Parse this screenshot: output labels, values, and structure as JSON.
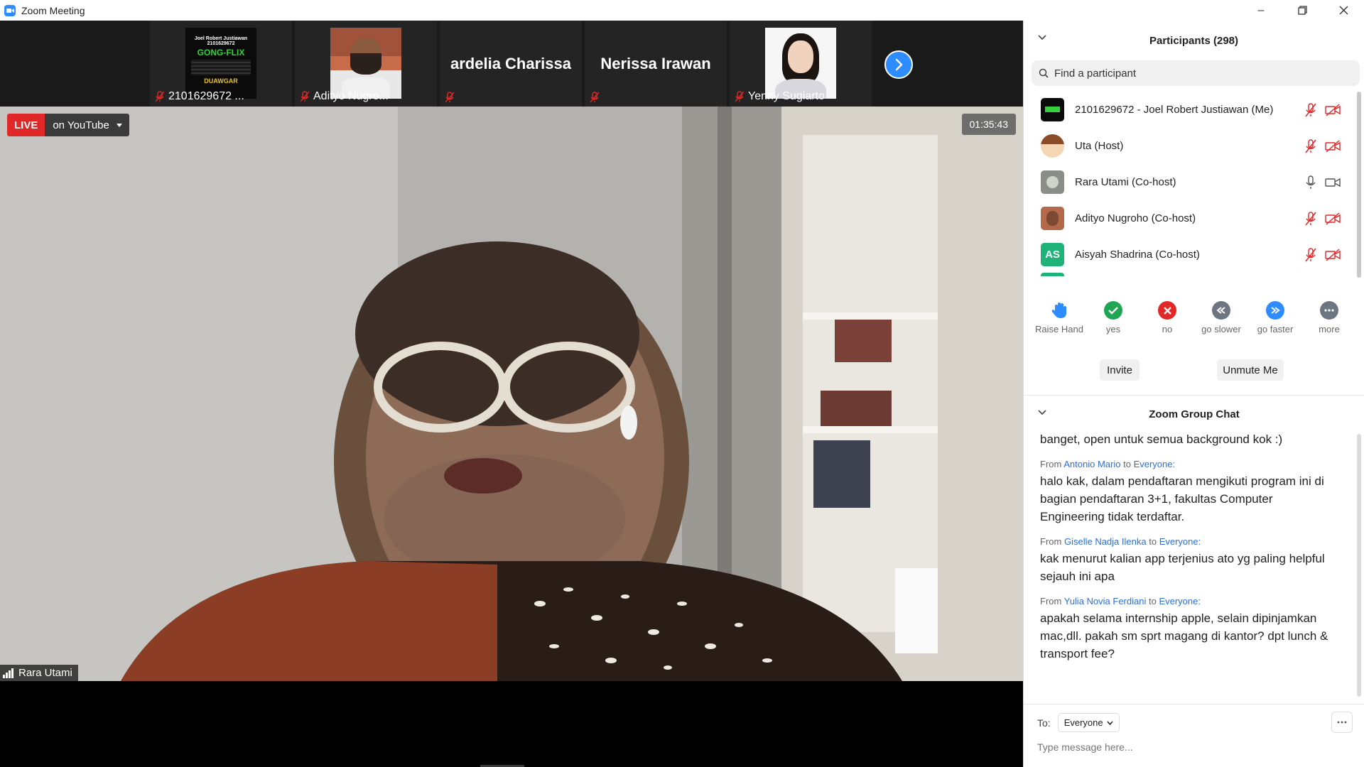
{
  "window": {
    "title": "Zoom Meeting"
  },
  "thumbnails": [
    {
      "name": "2101629672 ...",
      "image_text": [
        "Joel Robert Justiawan",
        "2101629672",
        "GONG-FLIX",
        "DUAWGAR"
      ]
    },
    {
      "name": "Adityo Nugro..."
    },
    {
      "name": "",
      "big_name": "ardelia Charissa"
    },
    {
      "name": "",
      "big_name": "Nerissa Irawan"
    },
    {
      "name": "Yenny Sugiarto"
    }
  ],
  "main_video": {
    "live_label": "LIVE",
    "stream_label": "on YouTube",
    "timer": "01:35:43",
    "speaker_name": "Rara Utami"
  },
  "participants": {
    "title": "Participants (298)",
    "search_placeholder": "Find a participant",
    "list": [
      {
        "name": "2101629672 - Joel Robert Justiawan (Me)",
        "mic": "muted",
        "video": "off"
      },
      {
        "name": "Uta (Host)",
        "mic": "muted",
        "video": "off"
      },
      {
        "name": "Rara Utami (Co-host)",
        "mic": "on",
        "video": "on"
      },
      {
        "name": "Adityo Nugroho (Co-host)",
        "mic": "muted",
        "video": "off"
      },
      {
        "name": "Aisyah Shadrina (Co-host)",
        "avatar_initials": "AS",
        "mic": "muted",
        "video": "off"
      }
    ]
  },
  "reactions": [
    {
      "label": "Raise Hand",
      "icon": "raise-hand-icon",
      "color": "#2d8cff"
    },
    {
      "label": "yes",
      "icon": "check-icon",
      "color": "#1fa655"
    },
    {
      "label": "no",
      "icon": "x-icon",
      "color": "#e02828"
    },
    {
      "label": "go slower",
      "icon": "rewind-icon",
      "color": "#6e7582"
    },
    {
      "label": "go faster",
      "icon": "fast-forward-icon",
      "color": "#2d8cff"
    },
    {
      "label": "more",
      "icon": "more-icon",
      "color": "#6e7582"
    }
  ],
  "panel_buttons": {
    "invite": "Invite",
    "unmute": "Unmute Me"
  },
  "chat": {
    "title": "Zoom Group Chat",
    "partial_text": "banget, open untuk semua background kok :)",
    "messages": [
      {
        "from_prefix": "From",
        "from": "Antonio Mario",
        "to_prefix": "to",
        "to": "Everyone:",
        "text": "halo kak, dalam pendaftaran mengikuti program ini di bagian pendaftaran 3+1, fakultas Computer Engineering tidak terdaftar."
      },
      {
        "from_prefix": "From",
        "from": "Giselle Nadja Ilenka",
        "to_prefix": "to",
        "to": "Everyone:",
        "text": "kak menurut kalian app terjenius ato yg paling helpful sejauh ini apa"
      },
      {
        "from_prefix": "From",
        "from": "Yulia Novia Ferdiani",
        "to_prefix": "to",
        "to": "Everyone:",
        "text": "apakah selama internship apple, selain dipinjamkan mac,dll. pakah sm sprt magang di kantor? dpt lunch & transport fee?"
      }
    ],
    "to_label": "To:",
    "to_value": "Everyone",
    "input_placeholder": "Type message here..."
  }
}
